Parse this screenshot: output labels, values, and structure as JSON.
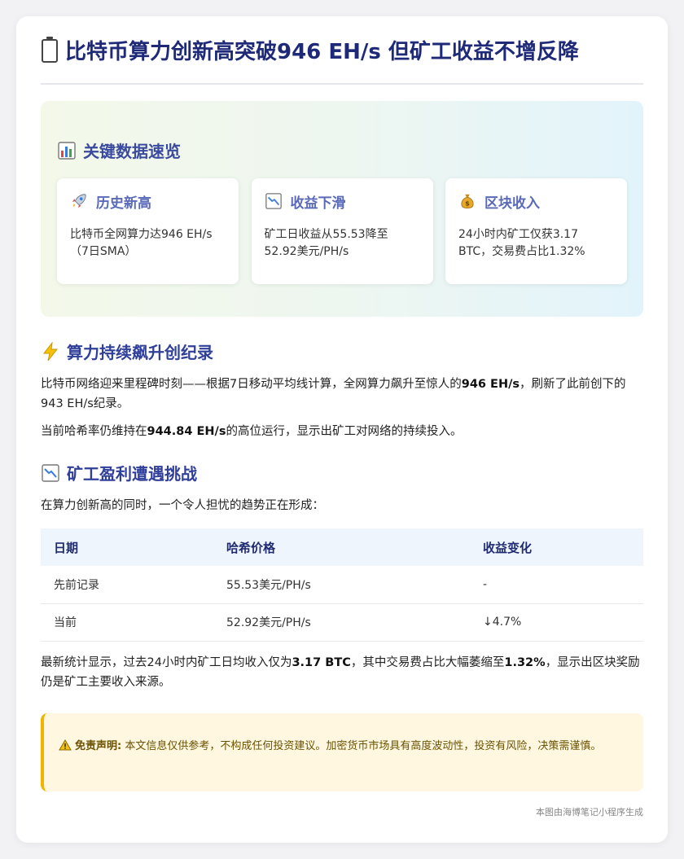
{
  "title": "比特币算力创新高突破946 EH/s 但矿工收益不增反降",
  "overview": {
    "heading": "关键数据速览",
    "cards": [
      {
        "icon": "rocket-icon",
        "title": "历史新高",
        "text": "比特币全网算力达946 EH/s（7日SMA）"
      },
      {
        "icon": "chart-down-icon",
        "title": "收益下滑",
        "text": "矿工日收益从55.53降至52.92美元/PH/s"
      },
      {
        "icon": "money-bag-icon",
        "title": "区块收入",
        "text": "24小时内矿工仅获3.17 BTC，交易费占比1.32%"
      }
    ]
  },
  "section1": {
    "heading": "算力持续飙升创纪录",
    "p1": {
      "a": "比特币网络迎来里程碑时刻——根据7日移动平均线计算，全网算力飙升至惊人的",
      "b": "946 EH/s",
      "c": "，刷新了此前创下的943 EH/s纪录。"
    },
    "p2": {
      "a": "当前哈希率仍维持在",
      "b": "944.84 EH/s",
      "c": "的高位运行，显示出矿工对网络的持续投入。"
    }
  },
  "section2": {
    "heading": "矿工盈利遭遇挑战",
    "intro": "在算力创新高的同时，一个令人担忧的趋势正在形成：",
    "table": {
      "headers": [
        "日期",
        "哈希价格",
        "收益变化"
      ],
      "rows": [
        [
          "先前记录",
          "55.53美元/PH/s",
          "-"
        ],
        [
          "当前",
          "52.92美元/PH/s",
          "↓4.7%"
        ]
      ]
    },
    "p3": {
      "a": "最新统计显示，过去24小时内矿工日均收入仅为",
      "b": "3.17 BTC",
      "c": "，其中交易费占比大幅萎缩至",
      "d": "1.32%",
      "e": "，显示出区块奖励仍是矿工主要收入来源。"
    }
  },
  "disclaimer": {
    "label": "免责声明:",
    "text": "本文信息仅供参考，不构成任何投资建议。加密货币市场具有高度波动性，投资有风险，决策需谨慎。"
  },
  "footer": "本图由海博笔记小程序生成",
  "colors": {
    "title": "#1e2a78",
    "heading": "#3a4a9f",
    "card_title": "#5a6ab8",
    "warning_border": "#f3b400",
    "warning_bg": "#fff7e0"
  }
}
